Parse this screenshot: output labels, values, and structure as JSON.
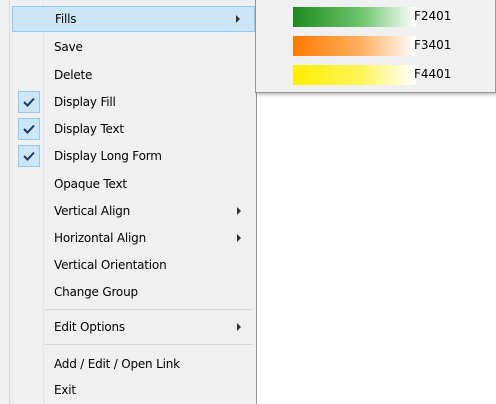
{
  "context_menu": {
    "items": [
      {
        "label": "Fills",
        "submenu": true,
        "highlighted": true
      },
      {
        "label": "Save"
      },
      {
        "label": "Delete"
      },
      {
        "label": "Display Fill",
        "checked": true
      },
      {
        "label": "Display Text",
        "checked": true
      },
      {
        "label": "Display Long Form",
        "checked": true
      },
      {
        "label": "Opaque Text"
      },
      {
        "label": "Vertical Align",
        "submenu": true
      },
      {
        "label": "Horizontal Align",
        "submenu": true
      },
      {
        "label": "Vertical Orientation"
      },
      {
        "label": "Change Group"
      },
      {
        "label": "Edit Options",
        "submenu": true
      },
      {
        "label": "Add / Edit / Open Link"
      },
      {
        "label": "Exit"
      }
    ]
  },
  "fills_submenu": {
    "items": [
      {
        "label": "F2401",
        "color": "#1f8a1f"
      },
      {
        "label": "F3401",
        "color": "#ff7a00"
      },
      {
        "label": "F4401",
        "color": "#ffee00"
      }
    ]
  },
  "icons": {
    "check": "check-icon",
    "submenu_arrow": "chevron-right-icon"
  },
  "colors": {
    "menu_bg": "#f0f0f0",
    "highlight": "#cde6f7",
    "highlight_border": "#90c8f6",
    "check": "#1a3a6e"
  }
}
